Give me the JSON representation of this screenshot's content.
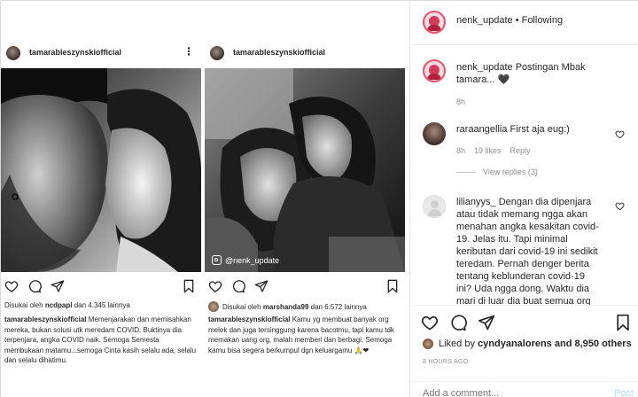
{
  "posts": [
    {
      "username": "tamarableszynskiofficial",
      "liked_by_user": "ncdpapl",
      "liked_by_text": "Disukai oleh",
      "and_others": "dan 4.345 lainnya",
      "caption_user": "tamarableszynskiofficial",
      "caption": "Memenjarakan dan memisahkan mereka, bukan solusi utk meredam COVID. Buktinya dia terpenjara, angka COVID naik. Semoga Semesta membukaan matamu...semoga Cinta kasih selalu ada, selalu dan selalu dihatimu."
    },
    {
      "username": "tamarableszynskiofficial",
      "watermark": "@nenk_update",
      "liked_by_user": "marshanda99",
      "liked_by_text": "Disukai oleh",
      "and_others": "dan 6.572 lainnya",
      "caption_user": "tamarableszynskiofficial",
      "caption": "Kamu yg membuat banyak org melek dan juga tersinggung karena bacotmu, tapi kamu tdk memakan uang org, malah memberi dan berbagi. Semoga kamu bisa segera berkumpul dgn keluargamu 🙏❤"
    }
  ],
  "panel": {
    "header_user": "nenk_update",
    "header_sep": " • ",
    "header_follow": "Following",
    "main_comment_user": "nenk_update",
    "main_comment_line1": "Postingan Mbak",
    "main_comment_line2": "tamara... 🖤",
    "main_comment_time": "8h",
    "comments": [
      {
        "user": "raraangellia",
        "text": "First aja eug:)",
        "time": "8h",
        "likes": "19 likes",
        "reply": "Reply",
        "view_replies": "View replies (3)"
      },
      {
        "user": "lilianyys_",
        "lines": [
          "Dengan dia dipenjara",
          "atau tidak memang ngga akan",
          "menahan angka kesakitan covid-",
          "19. Jelas itu. Tapi minimal",
          "keributan dari covid-19 ini sedikit",
          "teredam. Pernah denger berita",
          "tentang keblunderan covid-19",
          "ini? Uda ngga dong. Waktu dia",
          "mari di luar dia buat semua org"
        ]
      }
    ],
    "liked_by_text": "Liked by",
    "liked_by_user": "cyndyanalorens",
    "and_others": "and 8,950 others",
    "time_ago": "8 HOURS AGO",
    "add_comment_placeholder": "Add a comment...",
    "post_label": "Post"
  },
  "colors": {
    "text": "#262626",
    "muted": "#8e8e8e",
    "post_disabled": "#b2dffc",
    "avatar_ring": "#e3566f"
  }
}
